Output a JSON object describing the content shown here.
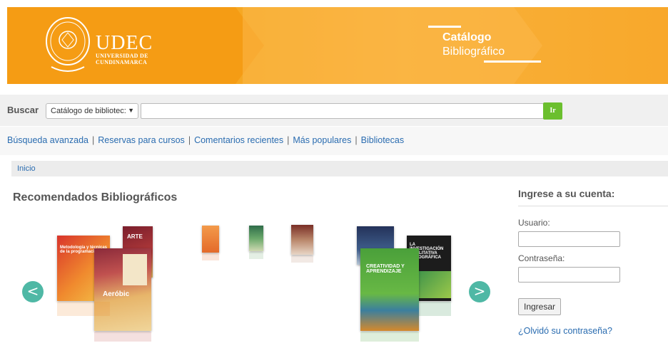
{
  "header": {
    "logo_main": "UDEC",
    "logo_sub1": "UNIVERSIDAD DE",
    "logo_sub2": "CUNDINAMARCA",
    "catalog_title": "Catálogo",
    "catalog_subtitle": "Bibliográfico",
    "brand_color": "#f7a21a"
  },
  "search": {
    "label": "Buscar",
    "scope_selected": "Catálogo de bibliotec:",
    "query_value": "",
    "go_label": "Ir",
    "go_color": "#6bbf2e"
  },
  "links": [
    "Búsqueda avanzada",
    "Reservas para cursos",
    "Comentarios recientes",
    "Más populares",
    "Bibliotecas"
  ],
  "links_separator": "|",
  "breadcrumb": {
    "home": "Inicio"
  },
  "recommendations": {
    "title": "Recomendados Bibliográficos",
    "prev_icon": "chevron-left-icon",
    "next_icon": "chevron-right-icon",
    "prev_label": "<",
    "next_label": ">",
    "book_texts": {
      "metodologia": "Metodología y técnicas de la programación",
      "arte": "ARTE",
      "aerobic": "Aeróbic",
      "investigacion": "LA INVESTIGACIÓN CUALITATIVA ETNOGRÁFICA",
      "creatividad": "CREATIVIDAD Y APRENDIZAJE"
    }
  },
  "login": {
    "title": "Ingrese a su cuenta:",
    "user_label": "Usuario:",
    "password_label": "Contraseña:",
    "submit_label": "Ingresar",
    "forgot_label": "¿Olvidó su contraseña?"
  },
  "accent_link_color": "#2a6cb0"
}
